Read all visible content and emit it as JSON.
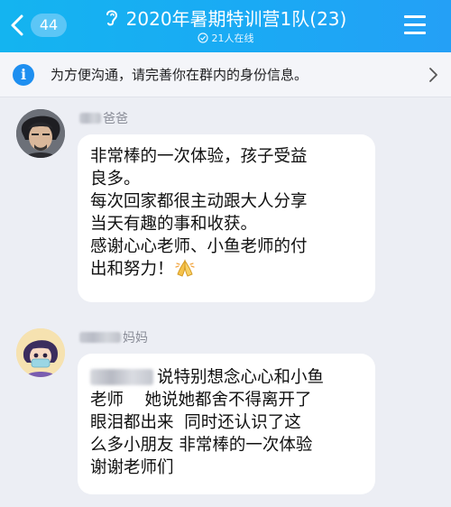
{
  "header": {
    "back_count": "44",
    "title": "2020年暑期特训营1队(23)",
    "subtitle": "21人在线"
  },
  "notice": {
    "text": "为方便沟通，请完善你在群内的身份信息。"
  },
  "messages": [
    {
      "sender_suffix": "爸爸",
      "lines": [
        "非常棒的一次体验，孩子受益",
        "良多。",
        "每次回家都很主动跟大人分享",
        "当天有趣的事和收获。",
        "感谢心心老师、小鱼老师的付",
        "出和努力！"
      ]
    },
    {
      "sender_suffix": "妈妈",
      "lines": [
        "说特别想念心心和小鱼",
        "老师    她说她都舍不得离开了",
        "眼泪都出来  同时还认识了这",
        "么多小朋友 非常棒的一次体验",
        "谢谢老师们"
      ]
    }
  ]
}
